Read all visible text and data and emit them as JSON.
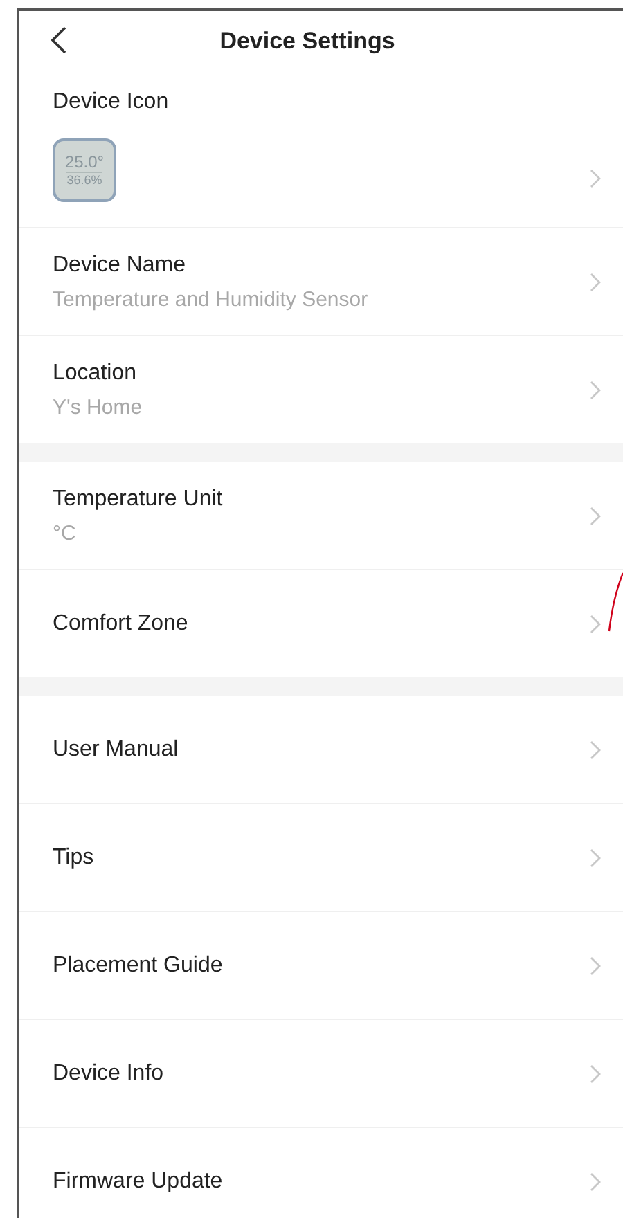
{
  "header": {
    "title": "Device Settings"
  },
  "sections": [
    {
      "items": [
        {
          "kind": "icon",
          "label": "Device Icon",
          "readings": [
            "25.0°",
            "36.6%"
          ]
        },
        {
          "kind": "value",
          "label": "Device Name",
          "value": "Temperature and Humidity Sensor"
        },
        {
          "kind": "value",
          "label": "Location",
          "value": "Y's Home"
        }
      ]
    },
    {
      "items": [
        {
          "kind": "value",
          "label": "Temperature Unit",
          "value": "°C"
        },
        {
          "kind": "plain",
          "label": "Comfort Zone"
        }
      ]
    },
    {
      "items": [
        {
          "kind": "plain",
          "label": "User Manual"
        },
        {
          "kind": "plain",
          "label": "Tips"
        },
        {
          "kind": "plain",
          "label": "Placement Guide"
        },
        {
          "kind": "plain",
          "label": "Device Info"
        },
        {
          "kind": "plain",
          "label": "Firmware Update"
        }
      ]
    }
  ]
}
